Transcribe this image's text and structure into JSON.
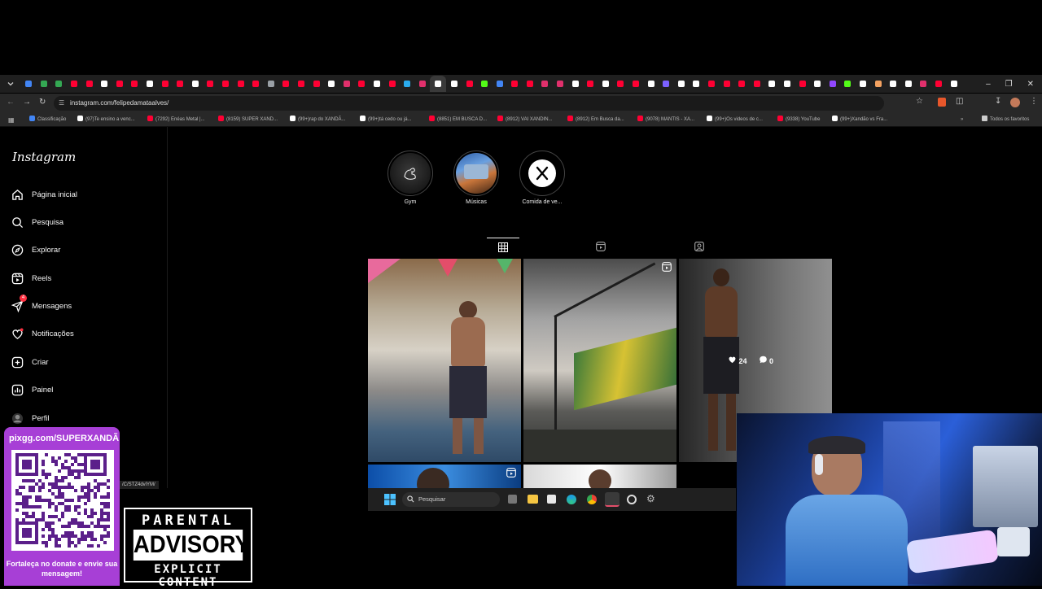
{
  "browser": {
    "url": "instagram.com/felipedamataalves/",
    "tab_colors": [
      "#4285f4",
      "#34a853",
      "#34a853",
      "#ff0033",
      "#ff0033",
      "#ffffff",
      "#ff0033",
      "#ff0033",
      "#ffffff",
      "#ff0033",
      "#ff0033",
      "#ffffff",
      "#ff0033",
      "#ff0033",
      "#ff0033",
      "#ff0033",
      "#9aa0a6",
      "#ff0033",
      "#ff0033",
      "#ff0033",
      "#ffffff",
      "#e1306c",
      "#ff0033",
      "#ffffff",
      "#ff0033",
      "#2aabee",
      "#e1306c",
      "#ffffff",
      "#ffffff",
      "#ff0033",
      "#53fc18",
      "#4285f4",
      "#ff0033",
      "#ff0033",
      "#e1306c",
      "#e1306c",
      "#ffffff",
      "#ff0033",
      "#ffffff",
      "#ff0033",
      "#ff0033",
      "#ffffff",
      "#7b61ff",
      "#ffffff",
      "#ffffff",
      "#ff0033",
      "#ff0033",
      "#ff0033",
      "#ff0033",
      "#ffffff",
      "#ffffff",
      "#ff0033",
      "#ffffff",
      "#9147ff",
      "#53fc18",
      "#ffffff",
      "#f4a261",
      "#ffffff",
      "#ffffff",
      "#e1306c",
      "#ff0033",
      "#ffffff",
      "#ff0033"
    ],
    "bookmarks": [
      {
        "label": "Classificação",
        "color": "#4285f4"
      },
      {
        "label": "(97)Te ensino a venc...",
        "color": "#ffffff"
      },
      {
        "label": "(7292) Enéas Metal |...",
        "color": "#ff0033"
      },
      {
        "label": "(8159) SUPER XAND...",
        "color": "#ff0033"
      },
      {
        "label": "(99+)rap do XANDÃ...",
        "color": "#ffffff"
      },
      {
        "label": "(99+)tá cedo ou já...",
        "color": "#ffffff"
      },
      {
        "label": "(8851) EM BUSCA D...",
        "color": "#ff0033"
      },
      {
        "label": "(8912) VAI XANDIN...",
        "color": "#ff0033"
      },
      {
        "label": "(8912) Em Busca da...",
        "color": "#ff0033"
      },
      {
        "label": "(9078) MANTIS - XA...",
        "color": "#ff0033"
      },
      {
        "label": "(99+)Os videos de c...",
        "color": "#ffffff"
      },
      {
        "label": "(9338) YouTube",
        "color": "#ff0033"
      },
      {
        "label": "(99+)Xandão vs Fra...",
        "color": "#ffffff"
      }
    ],
    "all_bookmarks": "Todos os favoritos",
    "status_url": "/C/STZ4dvlYM/"
  },
  "instagram": {
    "logo": "Instagram",
    "nav": [
      {
        "label": "Página inicial",
        "icon": "home-icon"
      },
      {
        "label": "Pesquisa",
        "icon": "search-icon"
      },
      {
        "label": "Explorar",
        "icon": "compass-icon"
      },
      {
        "label": "Reels",
        "icon": "reels-icon"
      },
      {
        "label": "Mensagens",
        "icon": "messenger-icon",
        "badge": "4"
      },
      {
        "label": "Notificações",
        "icon": "heart-icon"
      },
      {
        "label": "Criar",
        "icon": "plus-square-icon"
      },
      {
        "label": "Painel",
        "icon": "dashboard-icon"
      },
      {
        "label": "Perfil",
        "icon": "avatar"
      }
    ],
    "highlights": [
      {
        "label": "Gym"
      },
      {
        "label": "Músicas"
      },
      {
        "label": "Comida de ve..."
      }
    ],
    "profile_tabs": [
      "grid-icon",
      "reels-icon",
      "tagged-icon"
    ],
    "post_overlay": {
      "likes": "24",
      "comments": "0"
    }
  },
  "taskbar": {
    "search_placeholder": "Pesquisar"
  },
  "overlays": {
    "qr_url": "pixgg.com/SUPERXANDÃ",
    "qr_caption": "Fortaleça no donate e envie sua mensagem!",
    "advisory_line1": "PARENTAL",
    "advisory_line2": "ADVISORY",
    "advisory_line3": "EXPLICIT CONTENT"
  }
}
